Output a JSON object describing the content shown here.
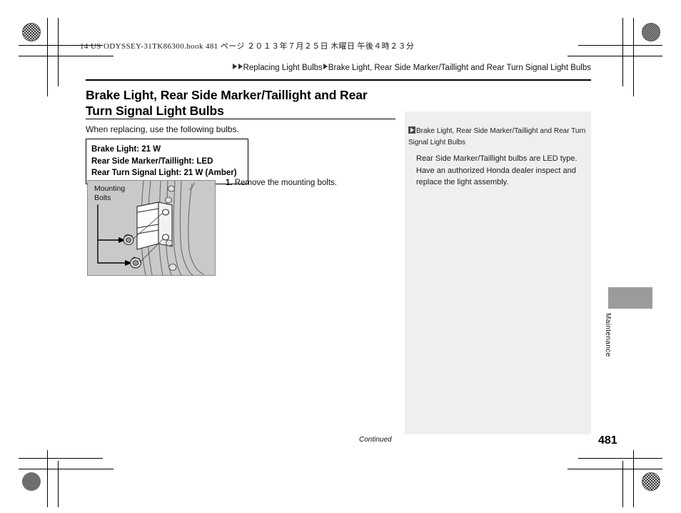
{
  "print_header": {
    "book_line": "14 US ODYSSEY-31TK86300.book   481 ページ   ２０１３年７月２５日   木曜日   午後４時２３分"
  },
  "breadcrumb": {
    "level1": "Replacing Light Bulbs",
    "level2": "Brake Light, Rear Side Marker/Taillight and Rear Turn Signal Light Bulbs"
  },
  "main": {
    "title": "Brake Light, Rear Side Marker/Taillight and Rear Turn Signal Light Bulbs",
    "intro": "When replacing, use the following bulbs.",
    "spec_box": {
      "line1": "Brake Light: 21 W",
      "line2": "Rear Side Marker/Taillight: LED",
      "line3": "Rear Turn Signal Light: 21 W (Amber)"
    },
    "figure": {
      "label_line1": "Mounting",
      "label_line2": "Bolts"
    },
    "steps": [
      {
        "number": "1.",
        "text": "Remove the mounting bolts."
      }
    ]
  },
  "side_panel": {
    "note_marker": "black-square-triangle-icon",
    "note_title": "Brake Light, Rear Side Marker/Taillight and Rear Turn Signal Light Bulbs",
    "note_body": "Rear Side Marker/Taillight bulbs are LED type. Have an authorized Honda dealer inspect and replace the light assembly."
  },
  "thumb_tab": {
    "label": "Maintenance"
  },
  "footer": {
    "continued": "Continued",
    "page_number": "481"
  },
  "colors": {
    "panel_gray": "#efefef",
    "figure_gray": "#c9c9c9",
    "tab_gray": "#9b9b9b"
  }
}
